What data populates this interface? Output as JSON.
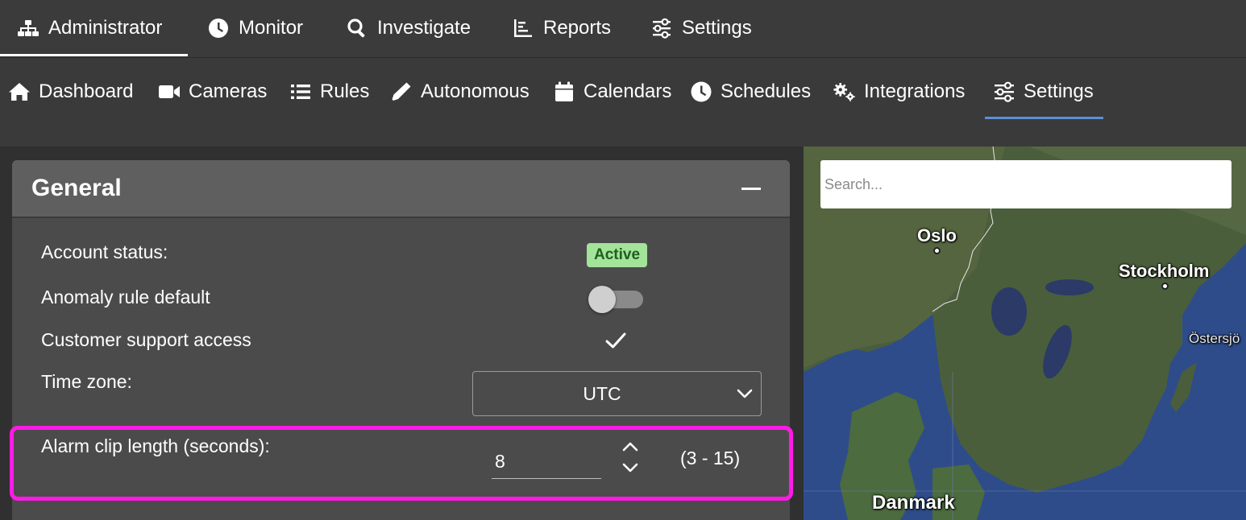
{
  "top_nav": {
    "items": [
      {
        "label": "Administrator",
        "icon": "org-chart-icon"
      },
      {
        "label": "Monitor",
        "icon": "clock-icon"
      },
      {
        "label": "Investigate",
        "icon": "search-icon"
      },
      {
        "label": "Reports",
        "icon": "bar-chart-icon"
      },
      {
        "label": "Settings",
        "icon": "sliders-icon"
      }
    ],
    "active": "Administrator"
  },
  "sub_nav": {
    "items": [
      {
        "label": "Dashboard",
        "icon": "home-icon"
      },
      {
        "label": "Cameras",
        "icon": "video-camera-icon"
      },
      {
        "label": "Rules",
        "icon": "list-icon"
      },
      {
        "label": "Autonomous",
        "icon": "pencil-icon"
      },
      {
        "label": "Calendars",
        "icon": "calendar-icon"
      },
      {
        "label": "Schedules",
        "icon": "clock-icon"
      },
      {
        "label": "Integrations",
        "icon": "cogs-icon"
      },
      {
        "label": "Settings",
        "icon": "sliders-icon"
      }
    ],
    "active": "Settings",
    "active_color": "#5d8fd8"
  },
  "general": {
    "title": "General",
    "account_status_label": "Account status:",
    "account_status_value": "Active",
    "anomaly_rule_label": "Anomaly rule default",
    "anomaly_rule_enabled": false,
    "customer_support_label": "Customer support access",
    "customer_support_enabled": true,
    "time_zone_label": "Time zone:",
    "time_zone_value": "UTC",
    "alarm_clip_label": "Alarm clip length (seconds):",
    "alarm_clip_value": "8",
    "alarm_clip_range": "(3 - 15)",
    "highlight_color": "#ff1ae6"
  },
  "map": {
    "search_placeholder": "Search...",
    "labels": {
      "oslo": "Oslo",
      "stockholm": "Stockholm",
      "ostersjon": "Östersjö",
      "danmark": "Danmark"
    }
  }
}
